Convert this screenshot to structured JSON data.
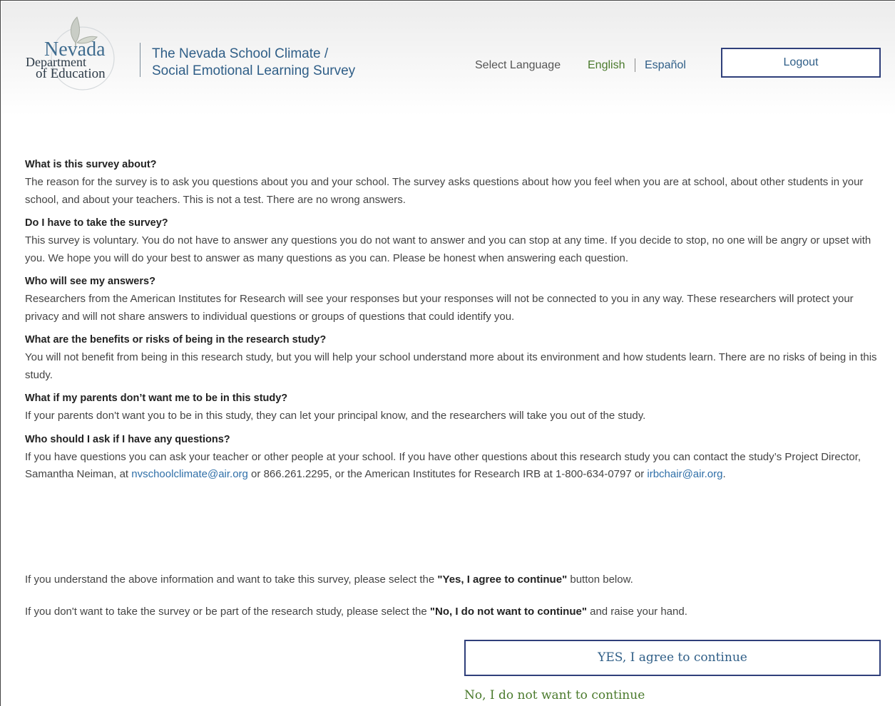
{
  "header": {
    "logo": {
      "line1": "Nevada",
      "line2": "Department",
      "line3": "of Education",
      "icon": "leaf-logo-icon"
    },
    "title_line1": "The Nevada School Climate /",
    "title_line2": "Social Emotional Learning Survey",
    "language_label": "Select Language",
    "language_english": "English",
    "language_spanish": "Español",
    "logout_label": "Logout"
  },
  "sections": [
    {
      "heading": "What is this survey about?",
      "body": "The reason for the survey is to ask you questions about you and your school. The survey asks questions about how you feel when you are at school, about other students in your school, and about your teachers. This is not a test. There are no wrong answers."
    },
    {
      "heading": "Do I have to take the survey?",
      "body": "This survey is voluntary. You do not have to answer any questions you do not want to answer and you can stop at any time. If you decide to stop, no one will be angry or upset with you. We hope you will do your best to answer as many questions as you can. Please be honest when answering each question."
    },
    {
      "heading": "Who will see my answers?",
      "body": "Researchers from the American Institutes for Research will see your responses but your responses will not be connected to you in any way. These researchers will protect your privacy and will not share answers to individual questions or groups of questions that could identify you."
    },
    {
      "heading": "What are the benefits or risks of being in the research study?",
      "body": "You will not benefit from being in this research study, but you will help your school understand more about its environment and how students learn. There are no risks of being in this study."
    },
    {
      "heading": "What if my parents don’t want me to be in this study?",
      "body": "If your parents don't want you to be in this study, they can let your principal know, and the researchers will take you out of the study."
    },
    {
      "heading": "Who should I ask if I have any questions?",
      "body_part1": "If you have questions you can ask your teacher or other people at your school. If you have other questions about this research study you can contact the study’s Project Director, Samantha Neiman, at ",
      "email1": "nvschoolclimate@air.org",
      "body_part2": " or 866.261.2295, or the American Institutes for Research IRB at 1-800-634-0797 or ",
      "email2": "irbchair@air.org",
      "body_part3": "."
    }
  ],
  "instructions": {
    "agree_pre": "If you understand the above information and want to take this survey, please select the ",
    "agree_bold": "\"Yes, I agree to continue\"",
    "agree_post": " button below.",
    "decline_pre": "If you don't want to take the survey or be part of the research study, please select the ",
    "decline_bold": "\"No, I do not want to continue\"",
    "decline_post": " and raise your hand."
  },
  "actions": {
    "yes_label": "YES, I agree to continue",
    "no_label": "No, I do not want to continue"
  },
  "colors": {
    "brand_blue": "#2f5e87",
    "button_border": "#2f3f7a",
    "english_green": "#4a7a2c",
    "link_blue": "#2f6fa8"
  }
}
